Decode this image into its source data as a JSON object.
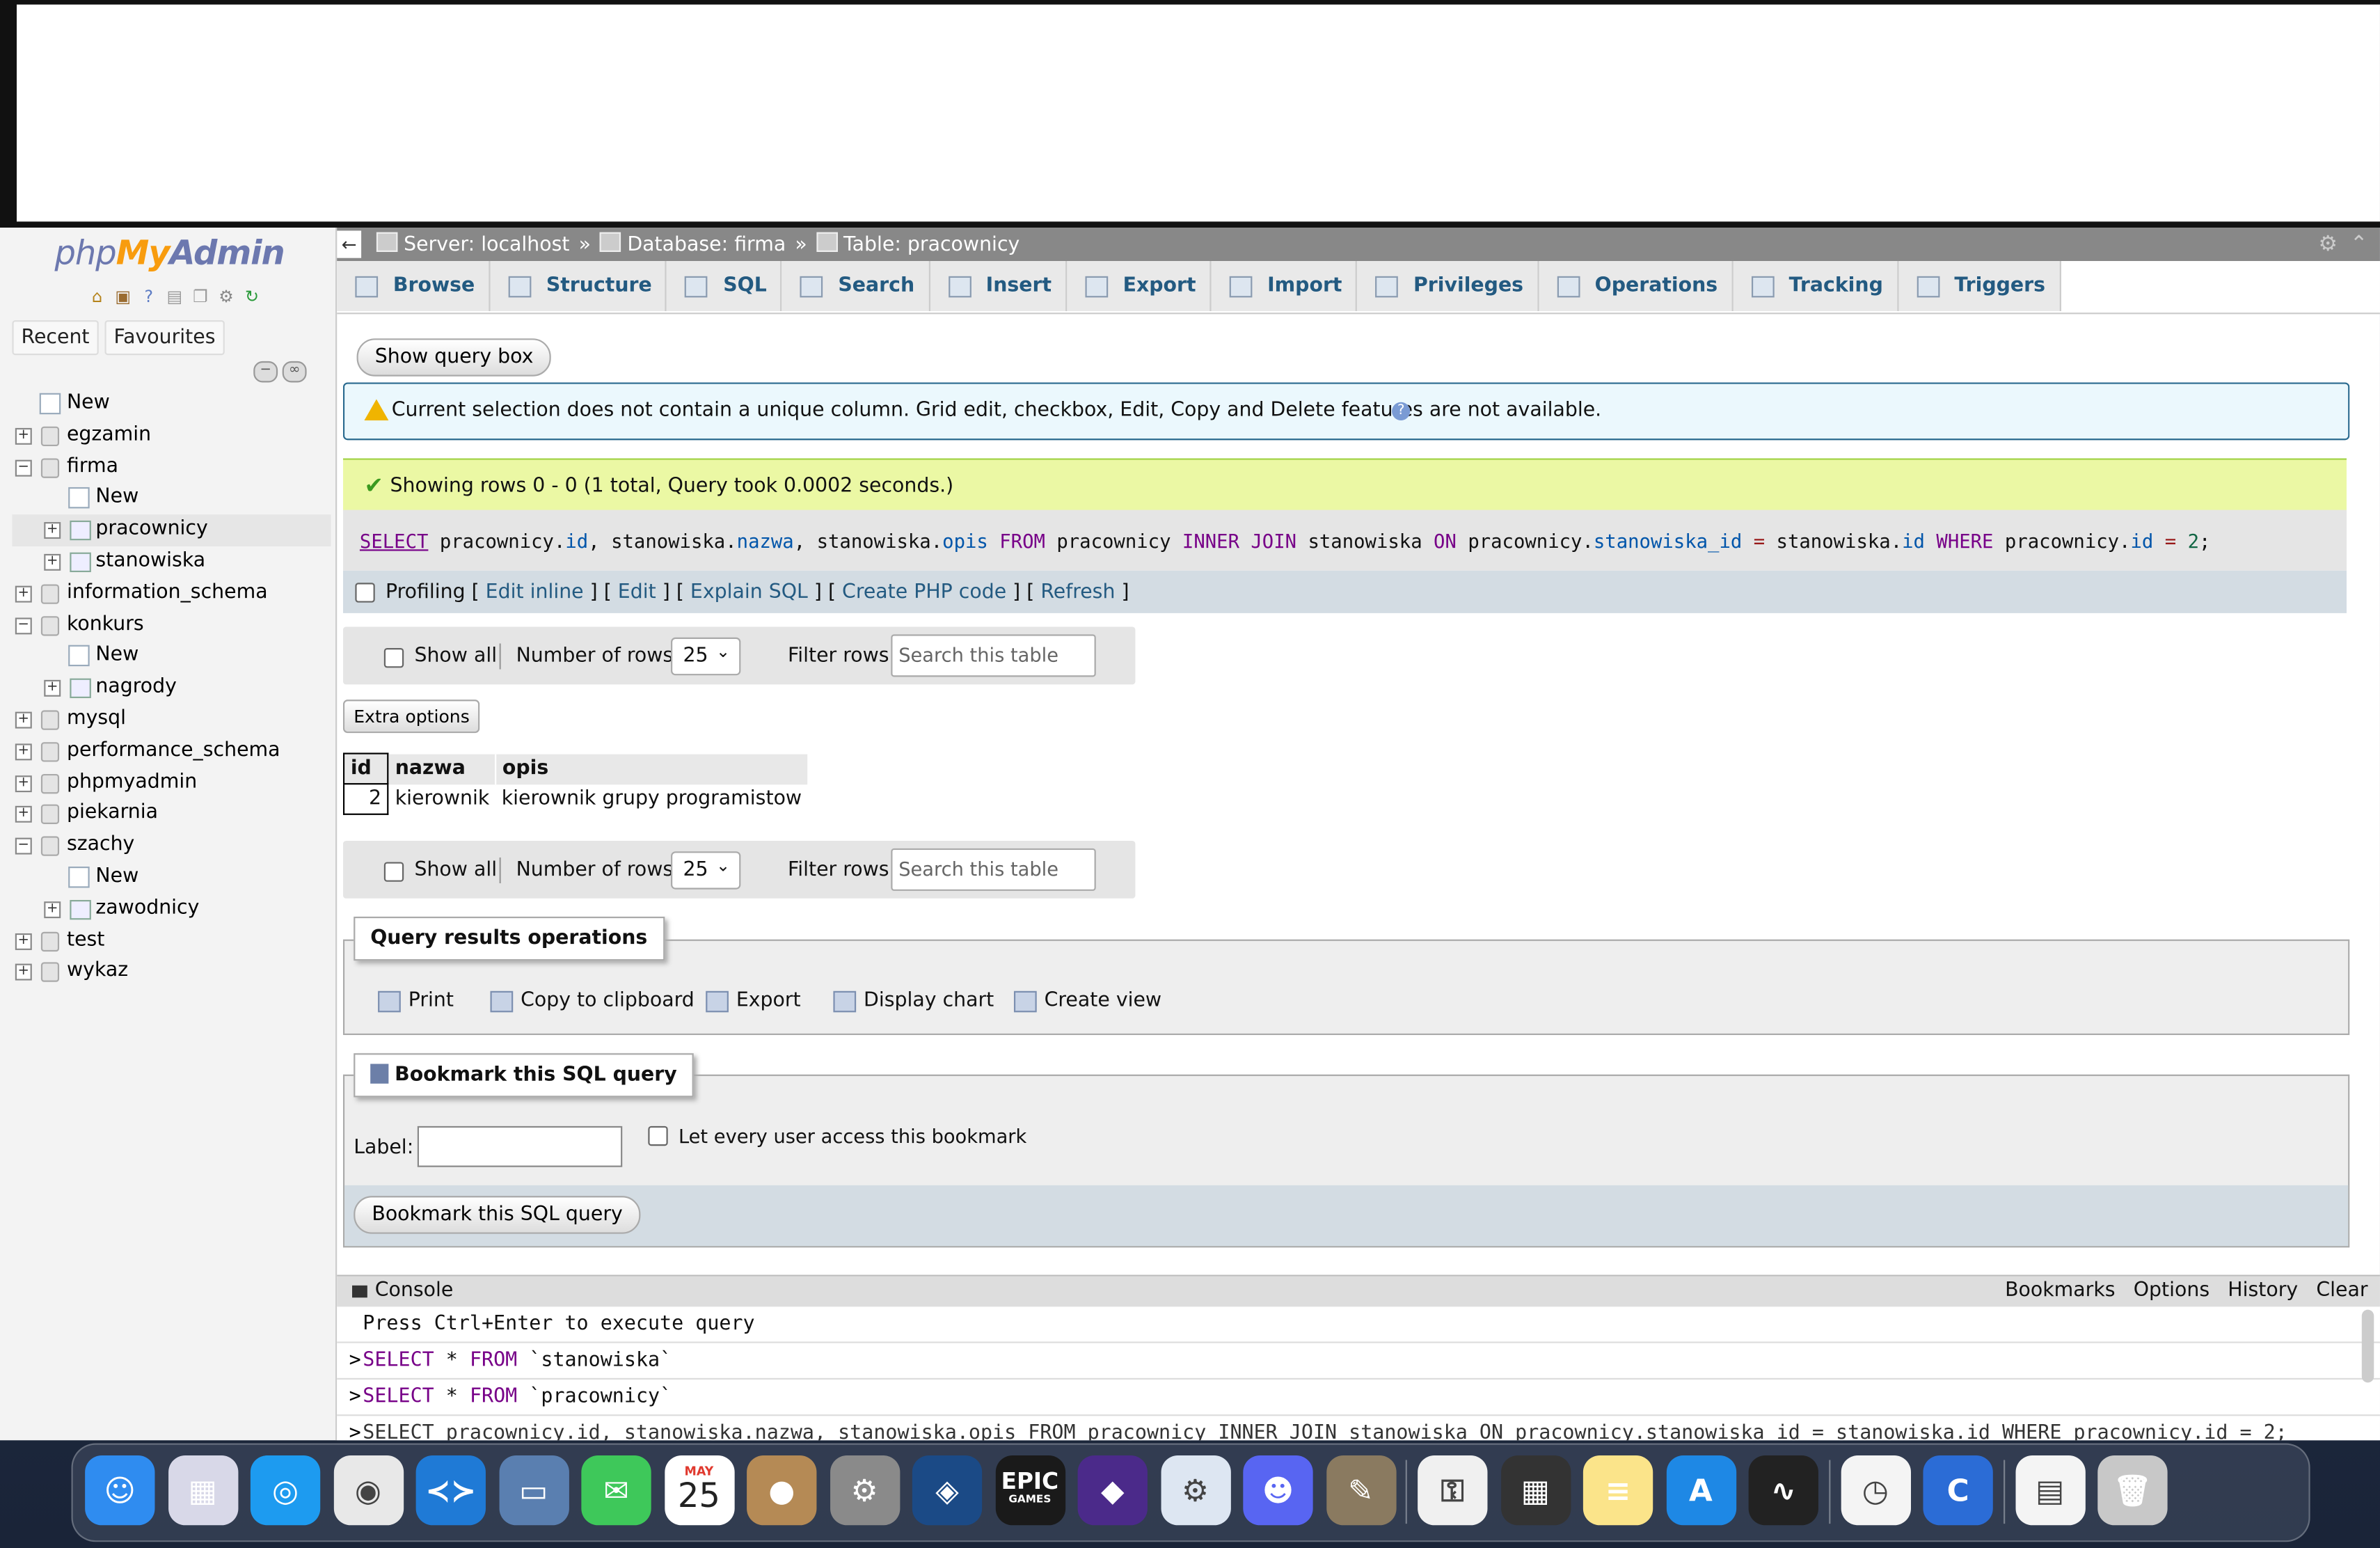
{
  "nav": {
    "logo_php": "php",
    "logo_my": "My",
    "logo_admin": "Admin",
    "tab_recent": "Recent",
    "tab_favourites": "Favourites",
    "tree": [
      {
        "label": "New",
        "kind": "new",
        "level": 0
      },
      {
        "label": "egzamin",
        "kind": "db",
        "level": 0,
        "expander": "+"
      },
      {
        "label": "firma",
        "kind": "db",
        "level": 0,
        "expander": "−"
      },
      {
        "label": "New",
        "kind": "new",
        "level": 1
      },
      {
        "label": "pracownicy",
        "kind": "table",
        "level": 1,
        "expander": "+",
        "selected": true
      },
      {
        "label": "stanowiska",
        "kind": "table",
        "level": 1,
        "expander": "+"
      },
      {
        "label": "information_schema",
        "kind": "db",
        "level": 0,
        "expander": "+"
      },
      {
        "label": "konkurs",
        "kind": "db",
        "level": 0,
        "expander": "−"
      },
      {
        "label": "New",
        "kind": "new",
        "level": 1
      },
      {
        "label": "nagrody",
        "kind": "table",
        "level": 1,
        "expander": "+"
      },
      {
        "label": "mysql",
        "kind": "db",
        "level": 0,
        "expander": "+"
      },
      {
        "label": "performance_schema",
        "kind": "db",
        "level": 0,
        "expander": "+"
      },
      {
        "label": "phpmyadmin",
        "kind": "db",
        "level": 0,
        "expander": "+"
      },
      {
        "label": "piekarnia",
        "kind": "db",
        "level": 0,
        "expander": "+"
      },
      {
        "label": "szachy",
        "kind": "db",
        "level": 0,
        "expander": "−"
      },
      {
        "label": "New",
        "kind": "new",
        "level": 1
      },
      {
        "label": "zawodnicy",
        "kind": "table",
        "level": 1,
        "expander": "+"
      },
      {
        "label": "test",
        "kind": "db",
        "level": 0,
        "expander": "+"
      },
      {
        "label": "wykaz",
        "kind": "db",
        "level": 0,
        "expander": "+"
      }
    ]
  },
  "breadcrumb": {
    "back": "←",
    "server": "Server: localhost",
    "database": "Database: firma",
    "table": "Table: pracownicy",
    "sep": "»"
  },
  "tabs": [
    "Browse",
    "Structure",
    "SQL",
    "Search",
    "Insert",
    "Export",
    "Import",
    "Privileges",
    "Operations",
    "Tracking",
    "Triggers"
  ],
  "content": {
    "show_query_box": "Show query box",
    "notice": "Current selection does not contain a unique column. Grid edit, checkbox, Edit, Copy and Delete features are not available.",
    "success": "Showing rows 0 - 0 (1 total, Query took 0.0002 seconds.)",
    "sql": {
      "select": "SELECT",
      "cols": " pracownicy.",
      "c1": "id",
      "c2pre": ", stanowiska.",
      "c2": "nazwa",
      "c3pre": ", stanowiska.",
      "c3": "opis",
      "from": "FROM",
      "t1": " pracownicy ",
      "join": "INNER JOIN",
      "t2": " stanowiska ",
      "on": "ON",
      "t1b": " pracownicy.",
      "f1": "stanowiska_id",
      "eq": "=",
      "t2b": " stanowiska.",
      "f2": "id",
      "where": "WHERE",
      "t1c": " pracownicy.",
      "f3": "id",
      "eq2": "=",
      "val": "2",
      "end": ";"
    },
    "profiling": {
      "label": "Profiling",
      "edit_inline": "Edit inline",
      "edit": "Edit",
      "explain": "Explain SQL",
      "php": "Create PHP code",
      "refresh": "Refresh"
    },
    "navbar": {
      "show_all": "Show all",
      "number_of_rows": "Number of rows:",
      "rows_value": "25",
      "filter_rows": "Filter rows:",
      "search_placeholder": "Search this table"
    },
    "extra_options": "Extra options",
    "table": {
      "headers": [
        "id",
        "nazwa",
        "opis"
      ],
      "rows": [
        [
          "2",
          "kierownik",
          "kierownik grupy programistow"
        ]
      ]
    },
    "query_ops": {
      "legend": "Query results operations",
      "print": "Print",
      "copy": "Copy to clipboard",
      "export": "Export",
      "chart": "Display chart",
      "view": "Create view"
    },
    "bookmark": {
      "legend": "Bookmark this SQL query",
      "label": "Label:",
      "every_user": "Let every user access this bookmark",
      "button": "Bookmark this SQL query"
    }
  },
  "console": {
    "title": "Console",
    "options": [
      "Bookmarks",
      "Options",
      "History",
      "Clear"
    ],
    "hint": "Press Ctrl+Enter to execute query",
    "history": [
      {
        "kw1": "SELECT",
        "star": " * ",
        "kw2": "FROM",
        "rest": " `stanowiska`"
      },
      {
        "kw1": "SELECT",
        "star": " * ",
        "kw2": "FROM",
        "rest": " `pracownicy`"
      }
    ],
    "last": "SELECT pracownicy.id, stanowiska.nazwa, stanowiska.opis FROM pracownicy INNER JOIN stanowiska ON pracownicy.stanowiska_id = stanowiska.id WHERE pracownicy.id = 2;"
  },
  "dock": {
    "calendar_month": "MAY",
    "calendar_day": "25",
    "epic_line1": "EPIC",
    "epic_line2": "GAMES",
    "apps": [
      "finder",
      "launchpad",
      "safari",
      "chrome",
      "vscode",
      "preview",
      "messages",
      "calendar",
      "contacts",
      "system-settings",
      "steam",
      "epic-games",
      "obsidian",
      "utility",
      "discord",
      "gimp",
      "keychain",
      "calculator",
      "notes",
      "app-store",
      "activity-monitor",
      "clock",
      "c-app",
      "document",
      "trash"
    ]
  }
}
